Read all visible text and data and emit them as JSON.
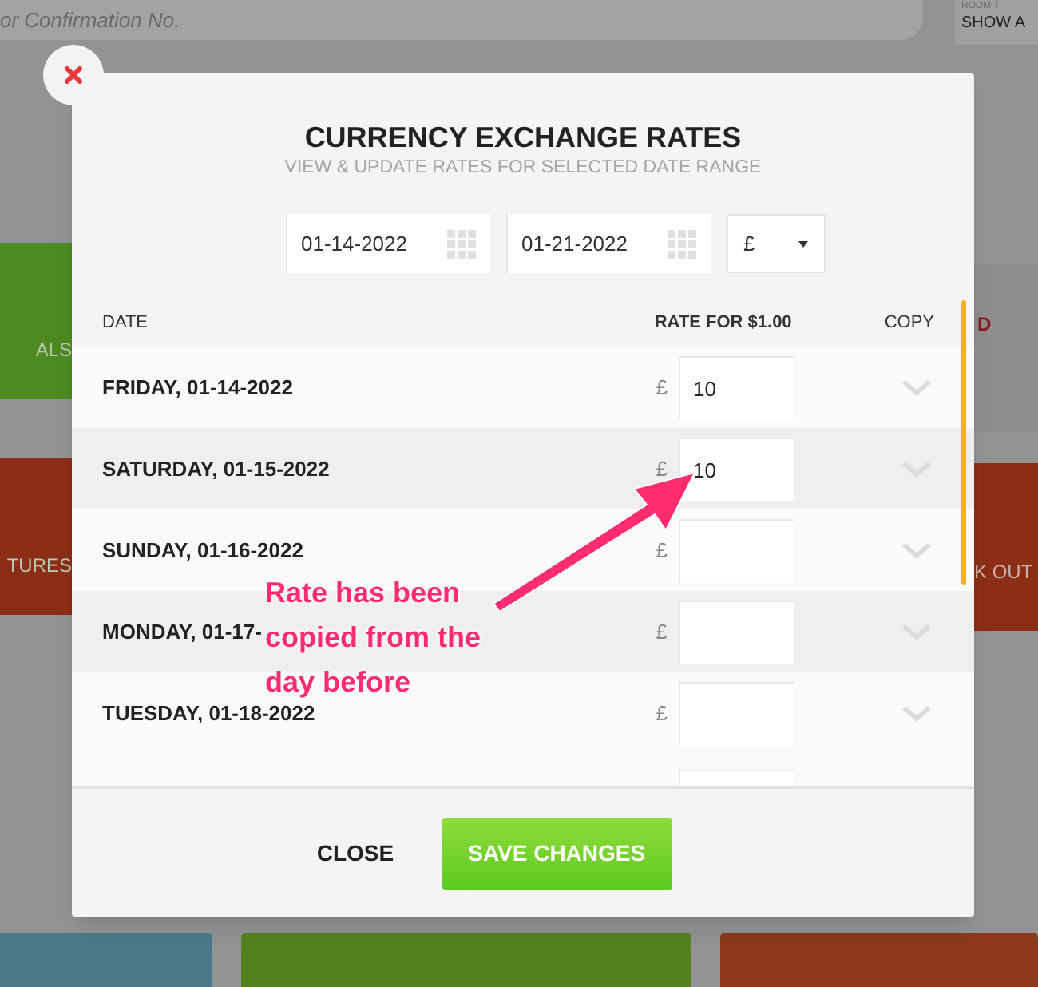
{
  "background": {
    "search_placeholder": "or Confirmation No.",
    "room_label": "ROOM T",
    "room_value": "SHOW A",
    "left_tiles": [
      {
        "label": "ALS",
        "color": "#4d8b22"
      },
      {
        "label": "TURES",
        "color": "#8c2e16"
      }
    ],
    "right_tiles": [
      {
        "label": "D",
        "color": "#8e8e8e"
      },
      {
        "label": "K OUT",
        "color": "#8c2e16"
      }
    ],
    "bottom_tiles": [
      {
        "color": "#4a7a88"
      },
      {
        "color": "#55821f"
      },
      {
        "color": "#8c3a19"
      }
    ]
  },
  "modal": {
    "title": "CURRENCY EXCHANGE RATES",
    "subtitle": "VIEW & UPDATE RATES FOR SELECTED DATE RANGE",
    "start_date": "01-14-2022",
    "end_date": "01-21-2022",
    "currency": "£",
    "columns": [
      "DATE",
      "RATE FOR $1.00",
      "COPY"
    ],
    "rows": [
      {
        "date": "FRIDAY, 01-14-2022",
        "symbol": "£",
        "rate": "10"
      },
      {
        "date": "SATURDAY, 01-15-2022",
        "symbol": "£",
        "rate": "10"
      },
      {
        "date": "SUNDAY, 01-16-2022",
        "symbol": "£"
      },
      {
        "date": "MONDAY, 01-17-",
        "symbol": "£"
      },
      {
        "date": "TUESDAY, 01-18-2022",
        "symbol": "£"
      }
    ],
    "partial_row_shown": true,
    "close_label": "CLOSE",
    "save_label": "SAVE CHANGES"
  },
  "annotation": {
    "lines": [
      "Rate has been",
      "copied from the",
      "day before"
    ]
  }
}
